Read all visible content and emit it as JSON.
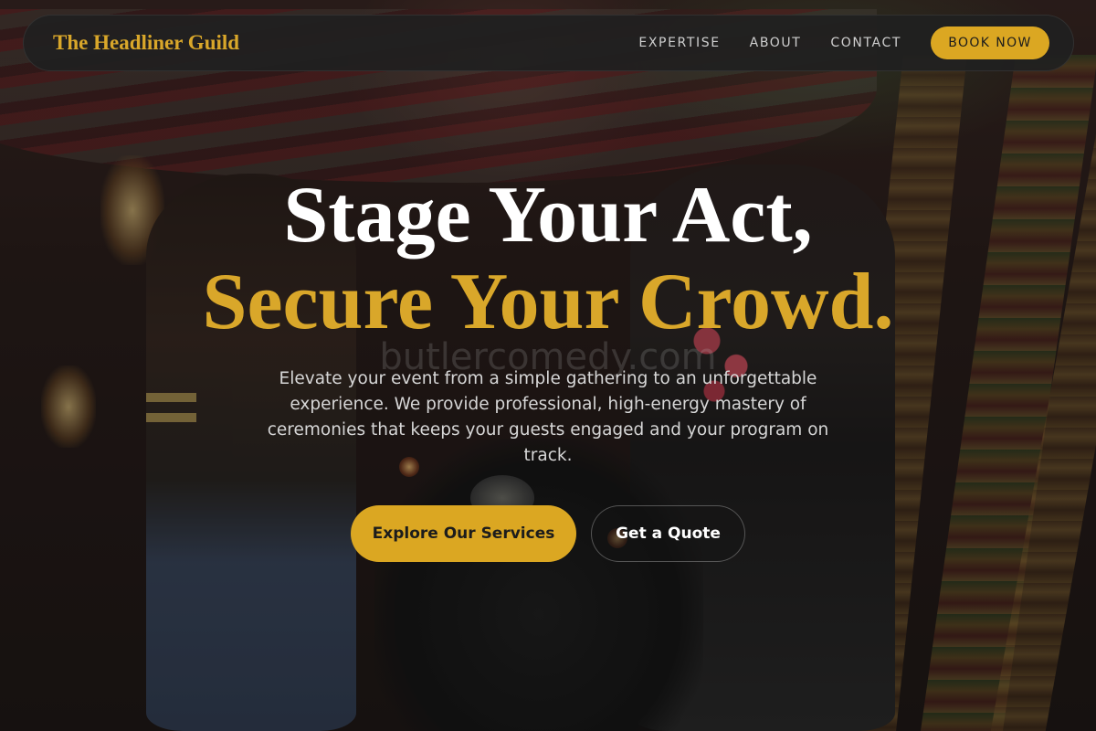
{
  "nav": {
    "brand": "The Headliner Guild",
    "links": [
      "EXPERTISE",
      "ABOUT",
      "CONTACT"
    ],
    "book_label": "BOOK NOW"
  },
  "hero": {
    "headline_line1": "Stage Your Act,",
    "headline_line2": "Secure Your Crowd.",
    "watermark": "butlercomedy.com",
    "subtitle": "Elevate your event from a simple gathering to an unforgettable experience. We provide professional, high-energy mastery of ceremonies that keeps your guests engaged and your program on track.",
    "primary_cta": "Explore Our Services",
    "secondary_cta": "Get a Quote"
  },
  "colors": {
    "accent": "#dba722",
    "nav_bg": "#202020",
    "text_light": "#ffffff"
  }
}
